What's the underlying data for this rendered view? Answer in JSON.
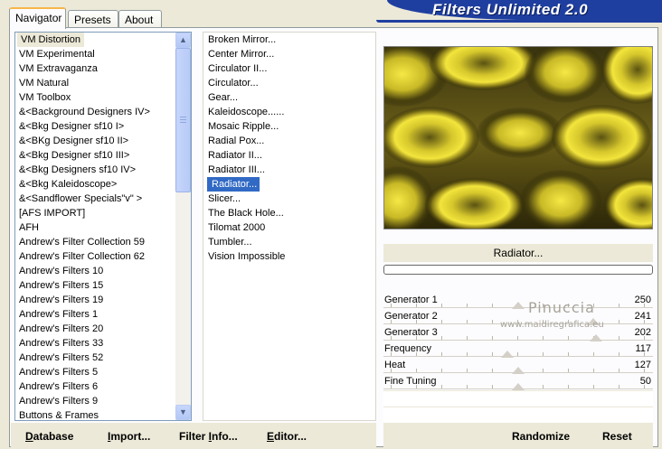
{
  "tabs": [
    {
      "label": "Navigator"
    },
    {
      "label": "Presets"
    },
    {
      "label": "About"
    }
  ],
  "banner": {
    "title": "Filters Unlimited 2.0"
  },
  "categories": [
    "VM Distortion",
    "VM Experimental",
    "VM Extravaganza",
    "VM Natural",
    "VM Toolbox",
    "&<Background Designers IV>",
    "&<Bkg Designer sf10 I>",
    "&<BKg Designer sf10 II>",
    "&<Bkg Designer sf10 III>",
    "&<Bkg Designers sf10 IV>",
    "&<Bkg Kaleidoscope>",
    "&<Sandflower Specials\"v\" >",
    "[AFS IMPORT]",
    "AFH",
    "Andrew's Filter Collection 59",
    "Andrew's Filter Collection 62",
    "Andrew's Filters 10",
    "Andrew's Filters 15",
    "Andrew's Filters 19",
    "Andrew's Filters 1",
    "Andrew's Filters 20",
    "Andrew's Filters 33",
    "Andrew's Filters 52",
    "Andrew's Filters 5",
    "Andrew's Filters 6",
    "Andrew's Filters 9",
    "Buttons & Frames"
  ],
  "filters": [
    "Broken Mirror...",
    "Center Mirror...",
    "Circulator II...",
    "Circulator...",
    "Gear...",
    "Kaleidoscope......",
    "Mosaic Ripple...",
    "Radial Pox...",
    "Radiator II...",
    "Radiator III...",
    "Radiator...",
    "Slicer...",
    "The Black Hole...",
    "Tilomat 2000",
    "Tumbler...",
    "Vision Impossible"
  ],
  "selected_filter_title": "Radiator...",
  "sliders": [
    {
      "label": "Generator 1",
      "value": "250"
    },
    {
      "label": "Generator 2",
      "value": "241"
    },
    {
      "label": "Generator 3",
      "value": "202"
    },
    {
      "label": "Frequency",
      "value": "117"
    },
    {
      "label": "Heat",
      "value": "127"
    },
    {
      "label": "Fine Tuning",
      "value": "50"
    }
  ],
  "watermark": {
    "line1": "Pinuccia",
    "line2": "www.maidiregrafica.eu"
  },
  "buttons": {
    "database": {
      "u": "D",
      "rest": "atabase"
    },
    "import": {
      "u": "I",
      "rest": "mport..."
    },
    "filter_info": {
      "pre": "Filter ",
      "u": "I",
      "rest": "nfo..."
    },
    "editor": {
      "u": "E",
      "rest": "ditor..."
    },
    "randomize": "Randomize",
    "reset": "Reset"
  },
  "colors": {
    "banner": "#1f3fa0",
    "selection": "#316ac5",
    "preview_yellow": "#e6d42a"
  }
}
